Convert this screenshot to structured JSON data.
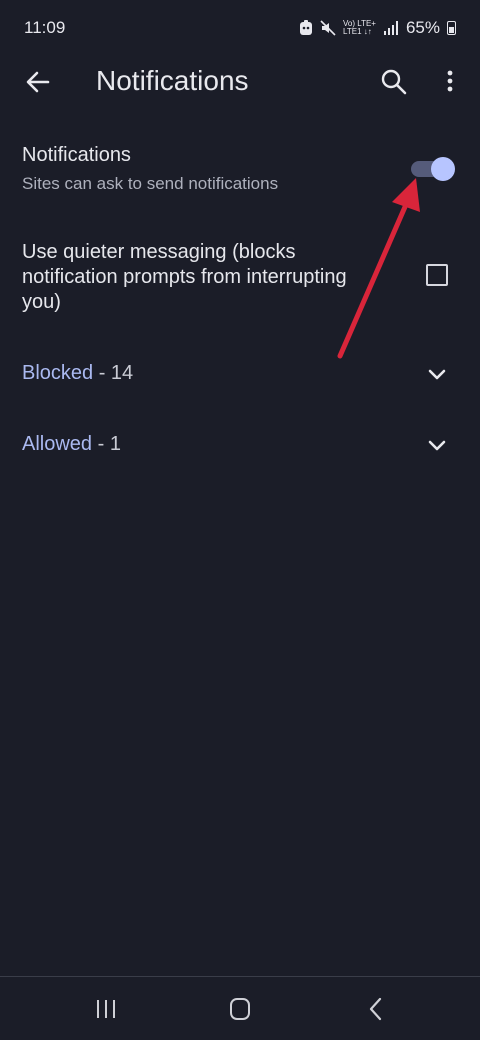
{
  "status": {
    "time": "11:09",
    "net_top": "Vo) LTE+",
    "net_bottom": "LTE1 ↓↑",
    "battery": "65%"
  },
  "appbar": {
    "title": "Notifications"
  },
  "notifications_setting": {
    "title": "Notifications",
    "subtitle": "Sites can ask to send notifications",
    "enabled": true
  },
  "quiet_setting": {
    "label": "Use quieter messaging (blocks notification prompts from interrupting you)",
    "checked": false
  },
  "sections": {
    "blocked": {
      "label": "Blocked",
      "count": " - 14"
    },
    "allowed": {
      "label": "Allowed",
      "count": " - 1"
    }
  },
  "colors": {
    "background": "#1b1d28",
    "accent": "#aab9f0",
    "toggle_thumb": "#b7c5ff",
    "annotation_arrow": "#d9253a"
  },
  "icons": [
    "back-arrow-icon",
    "search-icon",
    "more-vert-icon",
    "chevron-down-icon",
    "recents-icon",
    "home-icon",
    "nav-back-icon"
  ]
}
